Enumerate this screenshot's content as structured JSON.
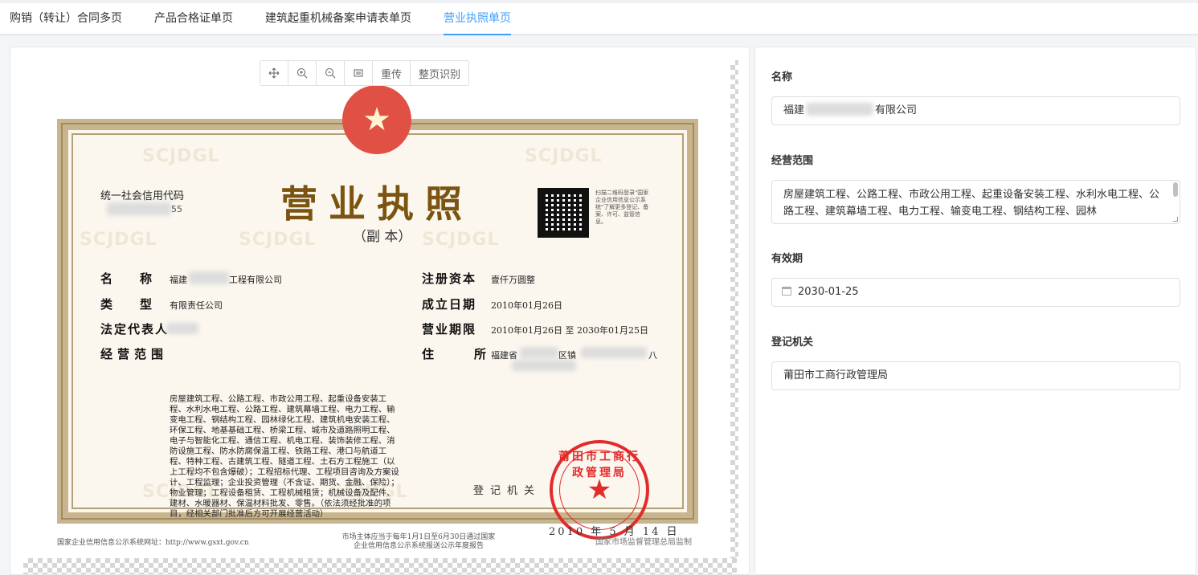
{
  "tabs": [
    {
      "label": "购销（转让）合同多页"
    },
    {
      "label": "产品合格证单页"
    },
    {
      "label": "建筑起重机械备案申请表单页"
    },
    {
      "label": "营业执照单页"
    }
  ],
  "toolbar": {
    "move_icon": "move-icon",
    "zoom_in_icon": "zoom-in-icon",
    "zoom_out_icon": "zoom-out-icon",
    "fit_icon": "fit-screen-icon",
    "reupload_label": "重传",
    "full_page_ocr_label": "整页识别"
  },
  "license": {
    "watermark": "SCJDGL",
    "code_label": "统一社会信用代码",
    "code_value_visible_end": "55",
    "title": "营业执照",
    "subtitle": "（副 本）",
    "qr_note": "扫描二维码登录\"国家企业信用信息公示系统\"了解更多登记、备案、许可、监管信息。",
    "name_label": "名称",
    "name_value_prefix": "福建",
    "name_value_suffix": "工程有限公司",
    "type_label": "类型",
    "type_value": "有限责任公司",
    "legal_rep_label": "法定代表人",
    "capital_label": "注册资本",
    "capital_value": "壹仟万圆整",
    "established_label": "成立日期",
    "established_value": "2010年01月26日",
    "term_label": "营业期限",
    "term_value": "2010年01月26日 至 2030年01月25日",
    "address_label": "住所",
    "address_value_prefix": "福建省",
    "address_value_mid": "区镇",
    "address_value_suffix": "八",
    "scope_label": "经营范围",
    "scope_value": "房屋建筑工程、公路工程、市政公用工程、起重设备安装工程、水利水电工程、公路工程、建筑幕墙工程、电力工程、输变电工程、钢结构工程、园林绿化工程、建筑机电安装工程、环保工程、地基基础工程、桥梁工程、城市及道路照明工程、电子与智能化工程、通信工程、机电工程、装饰装修工程、消防设施工程、防水防腐保温工程、铁路工程、港口与航道工程、特种工程、古建筑工程、隧道工程、土石方工程施工（以上工程均不包含爆破）；工程招标代理、工程项目咨询及方案设计、工程监理；企业投资管理（不含证、期货、金融、保险）；物业管理；工程设备租赁、工程机械租赁；机械设备及配件、建材、水暖器材、保温材料批发、零售。（依法须经批准的项目，经相关部门批准后方可开展经营活动）",
    "registration_label": "登记机关",
    "seal_text": "莆田市工商行政管理局",
    "registration_date": "2010 年 5 月 14 日",
    "footer_left": "国家企业信用信息公示系统网址：http://www.gsxt.gov.cn",
    "footer_center": "市场主体应当于每年1月1日至6月30日通过国家企业信用信息公示系统报送公示年度报告",
    "footer_right": "国家市场监督管理总局监制"
  },
  "form": {
    "name_label": "名称",
    "name_value_prefix": "福建",
    "name_value_suffix": "有限公司",
    "scope_label": "经营范围",
    "scope_value": "房屋建筑工程、公路工程、市政公用工程、起重设备安装工程、水利水电工程、公路工程、建筑幕墙工程、电力工程、输变电工程、钢结构工程、园林",
    "validity_label": "有效期",
    "validity_value": "2030-01-25",
    "calendar_icon": "calendar-icon",
    "authority_label": "登记机关",
    "authority_value": "莆田市工商行政管理局"
  },
  "colors": {
    "accent": "#409eff",
    "seal_red": "#e32b2b",
    "title_brown": "#7a5410"
  }
}
